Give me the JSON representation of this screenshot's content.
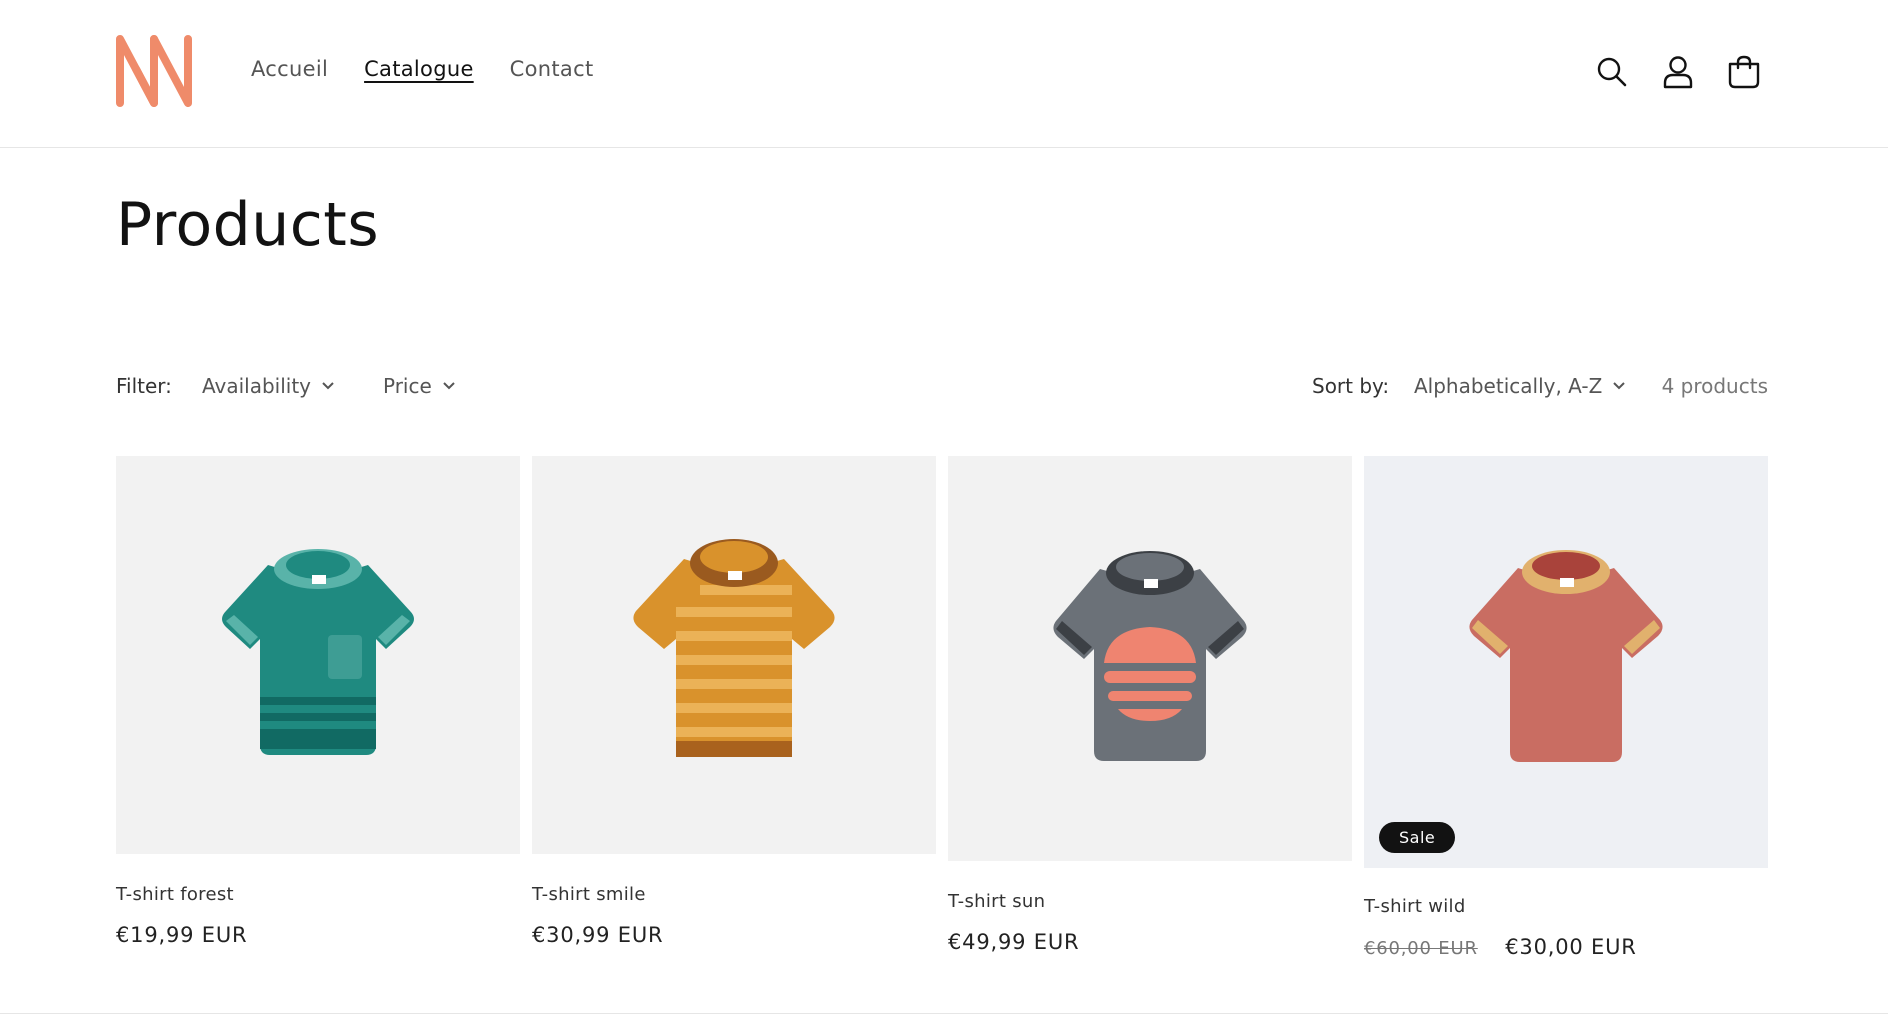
{
  "header": {
    "nav": [
      "Accueil",
      "Catalogue",
      "Contact"
    ],
    "active_nav": "Catalogue",
    "icons": [
      "search-icon",
      "account-icon",
      "cart-icon"
    ],
    "logo_color": "#ef8b6a"
  },
  "page": {
    "title": "Products"
  },
  "filters": {
    "label": "Filter:",
    "availability": "Availability",
    "price": "Price",
    "sort_label": "Sort by:",
    "sort_value": "Alphabetically, A-Z",
    "count": "4 products"
  },
  "products": [
    {
      "name": "T-shirt forest",
      "price": "€19,99 EUR",
      "color": "#1f8a80"
    },
    {
      "name": "T-shirt smile",
      "price": "€30,99 EUR",
      "color": "#d9922c"
    },
    {
      "name": "T-shirt sun",
      "price": "€49,99 EUR",
      "color": "#6b7178"
    },
    {
      "name": "T-shirt wild",
      "old_price": "€60,00 EUR",
      "price": "€30,00 EUR",
      "badge": "Sale",
      "color": "#c96d62"
    }
  ]
}
